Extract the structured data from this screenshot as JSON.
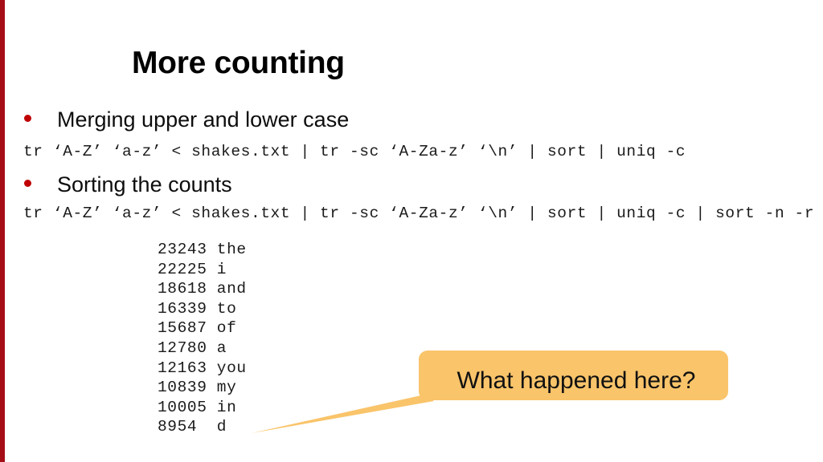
{
  "slide": {
    "title": "More counting",
    "accent_red": "#A50D17",
    "bullet_red": "#C00000",
    "callout_fill": "#F9C46A",
    "background": "#FFFFFF"
  },
  "bullets": [
    {
      "label": "Merging upper and lower case"
    },
    {
      "label": "Sorting the counts"
    }
  ],
  "code_lines": [
    {
      "text": "tr ‘A-Z’ ‘a-z’ < shakes.txt | tr -sc ‘A-Za-z’ ‘\\n’ | sort | uniq -c"
    },
    {
      "text": "tr ‘A-Z’ ‘a-z’ < shakes.txt | tr -sc ‘A-Za-z’ ‘\\n’ | sort | uniq -c | sort -n -r"
    }
  ],
  "counts_output": [
    {
      "count": "23243",
      "word": "the"
    },
    {
      "count": "22225",
      "word": "i"
    },
    {
      "count": "18618",
      "word": "and"
    },
    {
      "count": "16339",
      "word": "to"
    },
    {
      "count": "15687",
      "word": "of"
    },
    {
      "count": "12780",
      "word": "a"
    },
    {
      "count": "12163",
      "word": "you"
    },
    {
      "count": "10839",
      "word": "my"
    },
    {
      "count": "10005",
      "word": "in"
    },
    {
      "count": "8954",
      "word": "d"
    }
  ],
  "callout": {
    "text": "What happened here?"
  }
}
